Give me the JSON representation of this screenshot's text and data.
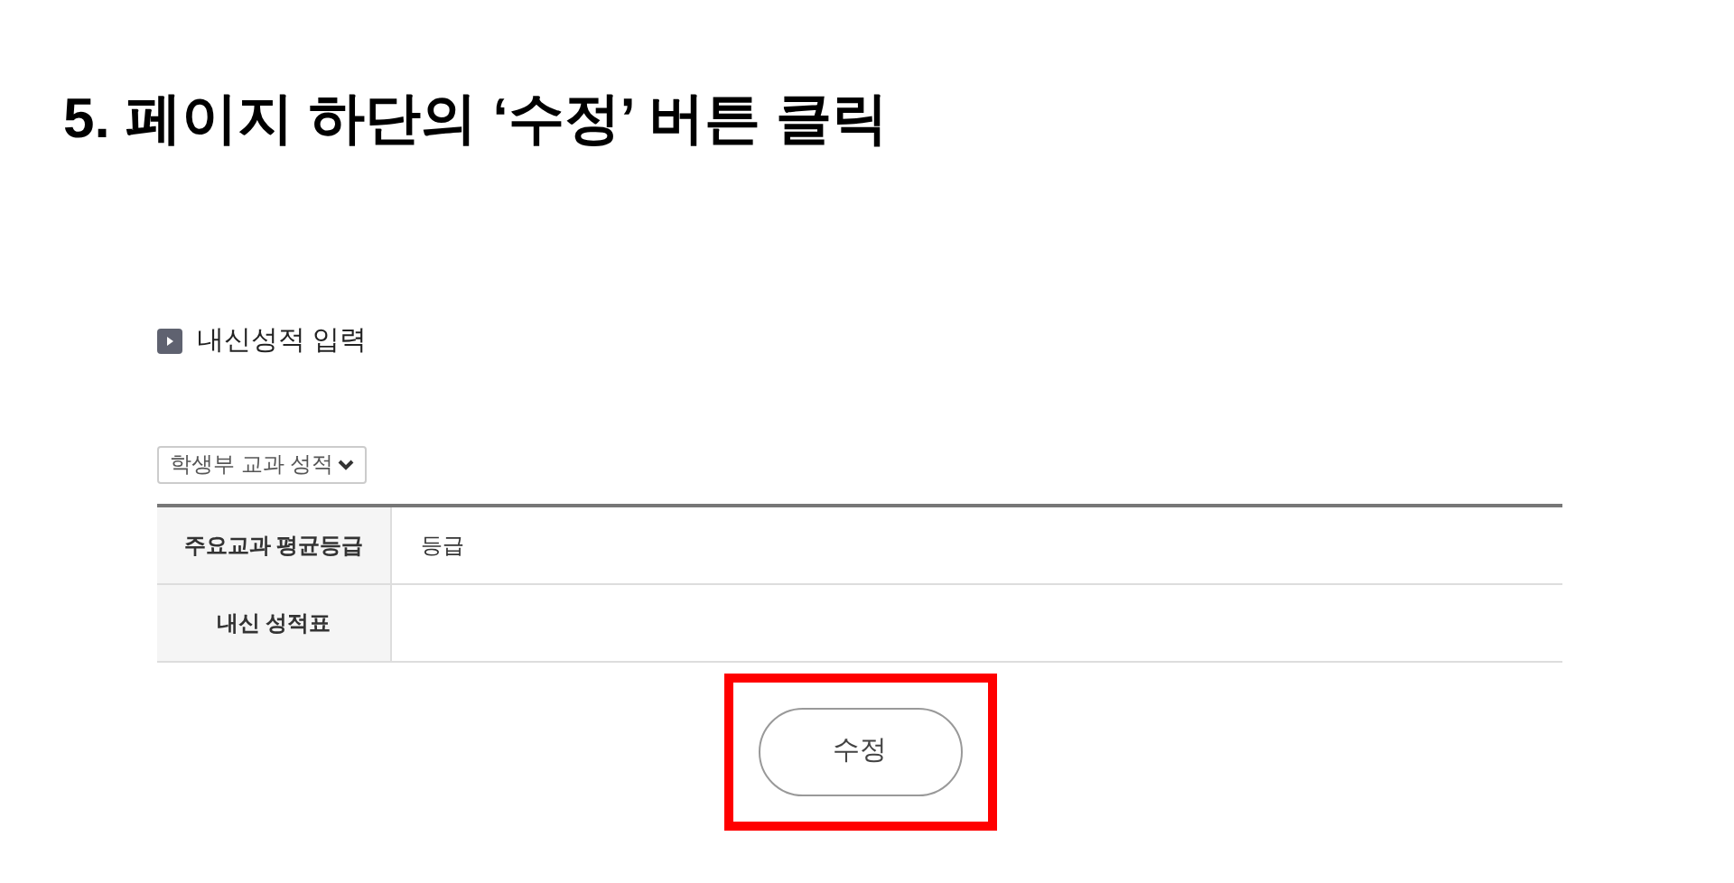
{
  "heading": "5. 페이지 하단의 ‘수정’ 버튼 클릭",
  "section_title": "내신성적 입력",
  "select": {
    "value": "학생부 교과 성적"
  },
  "table": {
    "rows": [
      {
        "label": "주요교과 평균등급",
        "value": "등급"
      },
      {
        "label": "내신 성적표"
      }
    ]
  },
  "button": {
    "label": "수정",
    "highlighted": true
  }
}
